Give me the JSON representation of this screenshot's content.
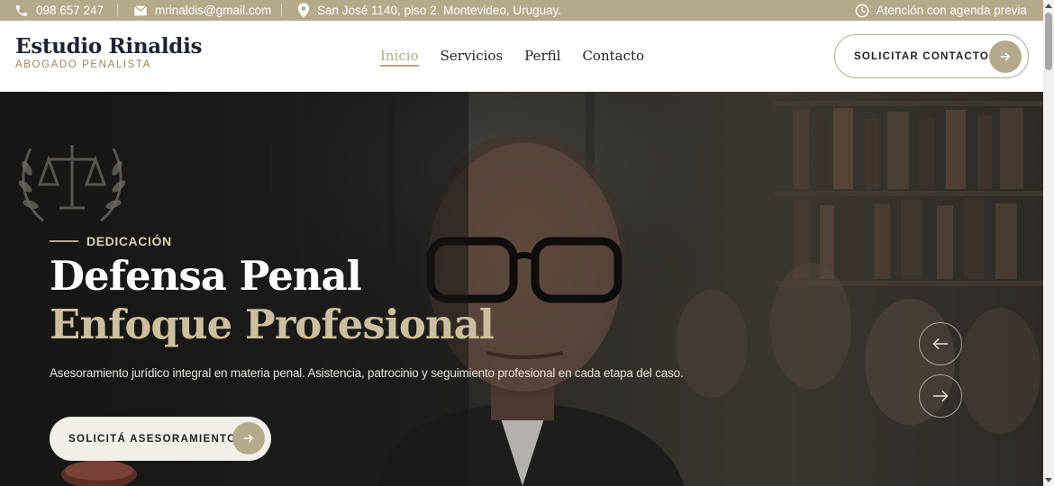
{
  "topbar": {
    "phone": "098 657 247",
    "email": "mrinaldis@gmail.com",
    "address": "San José 1140, piso 2. Montevideo, Uruguay.",
    "hours": "Atención con agenda previa"
  },
  "header": {
    "brand_name": "Estudio Rinaldis",
    "brand_tagline": "ABOGADO PENALISTA",
    "nav": [
      "Inicio",
      "Servicios",
      "Perfil",
      "Contacto"
    ],
    "active_nav": "Inicio",
    "cta_label": "SOLICITAR CONTACTO"
  },
  "hero": {
    "eyebrow": "DEDICACIÓN",
    "title_line1": "Defensa Penal",
    "title_line2": "Enfoque Profesional",
    "lead": "Asesoramiento jurídico integral en materia penal. Asistencia, patrocinio y seguimiento profesional en cada etapa del caso.",
    "button_label": "SOLICITÁ ASESORAMIENTO"
  },
  "colors": {
    "accent": "#b5a98c",
    "title_accent": "#cbbf9f",
    "brand_text": "#1d2430"
  },
  "icons": {
    "phone": "phone-icon",
    "email": "mail-icon",
    "address": "location-pin-icon",
    "hours": "clock-icon",
    "arrow": "arrow-right-icon",
    "prev": "arrow-left-icon",
    "next": "arrow-right-icon",
    "emblem": "scales-of-justice-icon"
  }
}
